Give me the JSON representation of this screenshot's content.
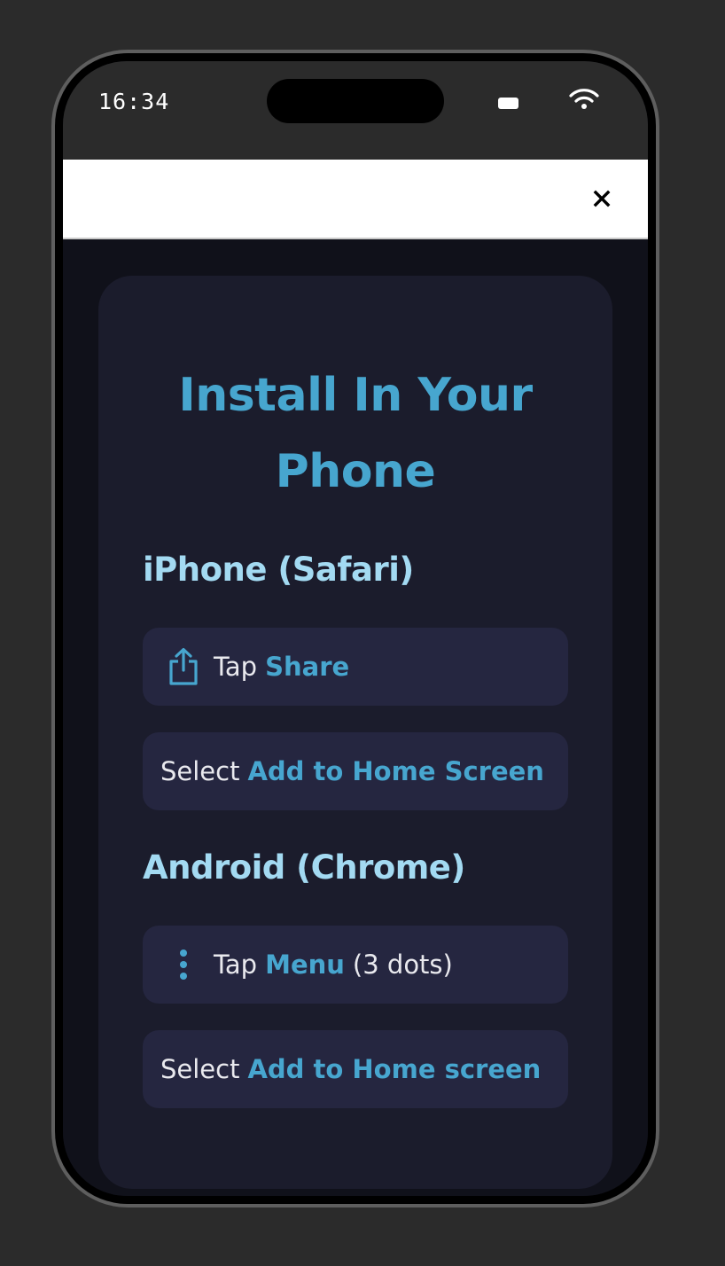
{
  "status_bar": {
    "time": "16:34"
  },
  "card": {
    "title": "Install In Your Phone"
  },
  "iphone": {
    "heading": "iPhone (Safari)",
    "step1": {
      "prefix": "Tap",
      "accent": "Share",
      "icon": "share-icon"
    },
    "step2": {
      "prefix": "Select",
      "accent": "Add to Home Screen"
    }
  },
  "android": {
    "heading": "Android (Chrome)",
    "step1": {
      "prefix": "Tap",
      "accent": "Menu",
      "suffix": "(3 dots)",
      "icon": "more-vertical-icon"
    },
    "step2": {
      "prefix": "Select",
      "accent": "Add to Home screen"
    }
  },
  "colors": {
    "accent": "#47a6cf",
    "heading": "#a3daf2",
    "card_bg": "#1b1c2c",
    "step_bg": "#252640",
    "page_bg": "#10111a"
  }
}
